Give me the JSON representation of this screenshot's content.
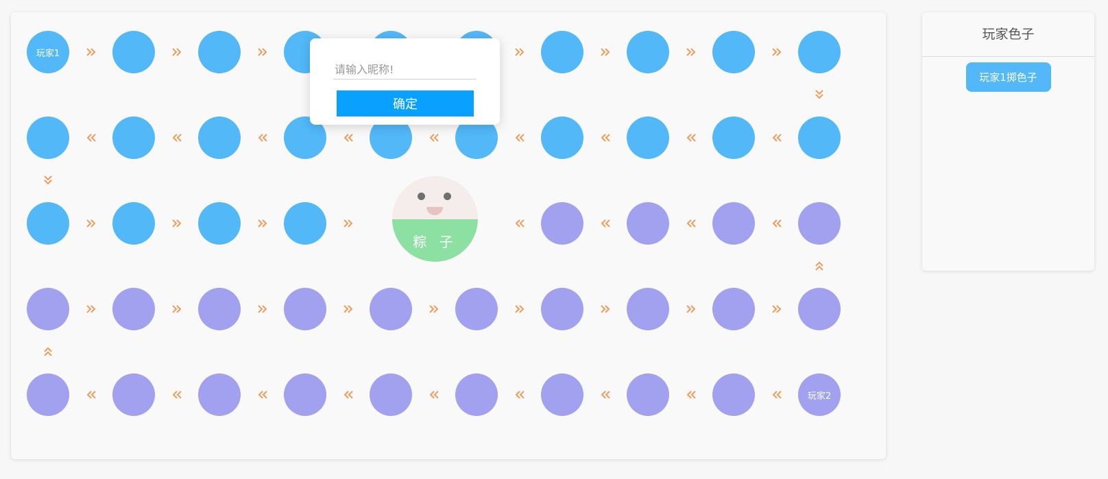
{
  "board": {
    "start_label": "玩家1",
    "end_label": "玩家2",
    "colors": {
      "player1_path": "#52b8f8",
      "player2_path": "#a1a1ef",
      "arrow": "#f39a57"
    }
  },
  "center_mascot": {
    "label": "粽 子"
  },
  "dice_panel": {
    "title": "玩家色子",
    "roll_button_label": "玩家1掷色子"
  },
  "nickname_dialog": {
    "placeholder": "请输入昵称!",
    "value": "",
    "confirm_label": "确定"
  }
}
